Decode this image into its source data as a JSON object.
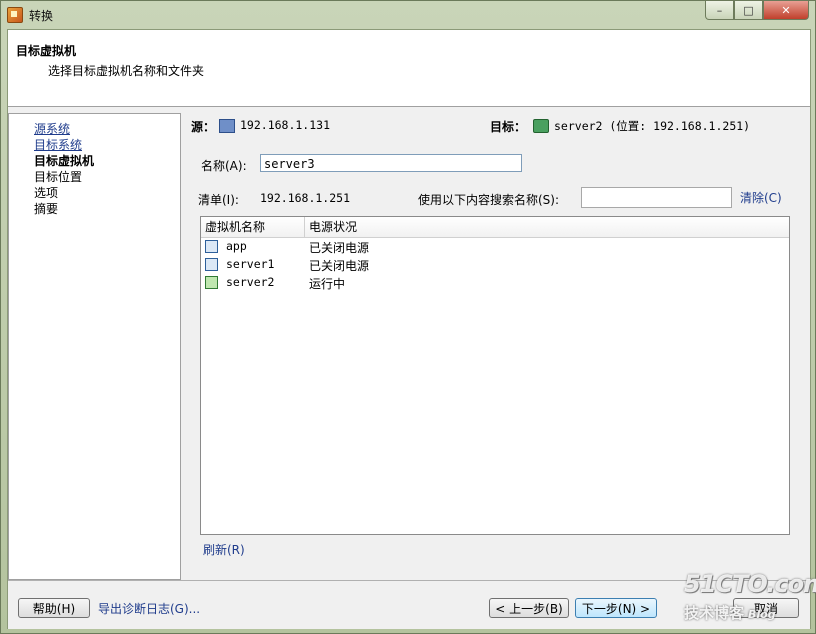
{
  "window": {
    "title": "转换",
    "min": "–",
    "max": "□",
    "close": "✕"
  },
  "header": {
    "title": "目标虚拟机",
    "subtitle": "选择目标虚拟机名称和文件夹"
  },
  "nav": [
    {
      "label": "源系统",
      "state": "link"
    },
    {
      "label": "目标系统",
      "state": "link"
    },
    {
      "label": "目标虚拟机",
      "state": "current"
    },
    {
      "label": "目标位置",
      "state": "normal"
    },
    {
      "label": "选项",
      "state": "normal"
    },
    {
      "label": "摘要",
      "state": "normal"
    }
  ],
  "source": {
    "label": "源：",
    "value": "192.168.1.131",
    "icon": "computer-icon"
  },
  "destination": {
    "label": "目标：",
    "value": "server2 (位置: 192.168.1.251)",
    "icon": "server-icon"
  },
  "name_field": {
    "label": "名称(A):",
    "value": "server3"
  },
  "inventory": {
    "label": "清单(I):",
    "value": "192.168.1.251"
  },
  "search": {
    "label": "使用以下内容搜索名称(S):",
    "value": "",
    "clear_label": "清除(C)"
  },
  "vm_table": {
    "columns": [
      "虚拟机名称",
      "电源状况"
    ],
    "rows": [
      {
        "name": "app",
        "power": "已关闭电源",
        "icon": "vm-off-icon"
      },
      {
        "name": "server1",
        "power": "已关闭电源",
        "icon": "vm-off-icon"
      },
      {
        "name": "server2",
        "power": "运行中",
        "icon": "vm-running-icon"
      }
    ]
  },
  "refresh_label": "刷新(R)",
  "footer": {
    "help": "帮助(H)",
    "export_log": "导出诊断日志(G)...",
    "back": "< 上一步(B)",
    "next": "下一步(N) >",
    "cancel": "取消"
  },
  "watermark": {
    "top": "51CTO.com",
    "bottom": "技术博客",
    "blog": "Blog"
  }
}
